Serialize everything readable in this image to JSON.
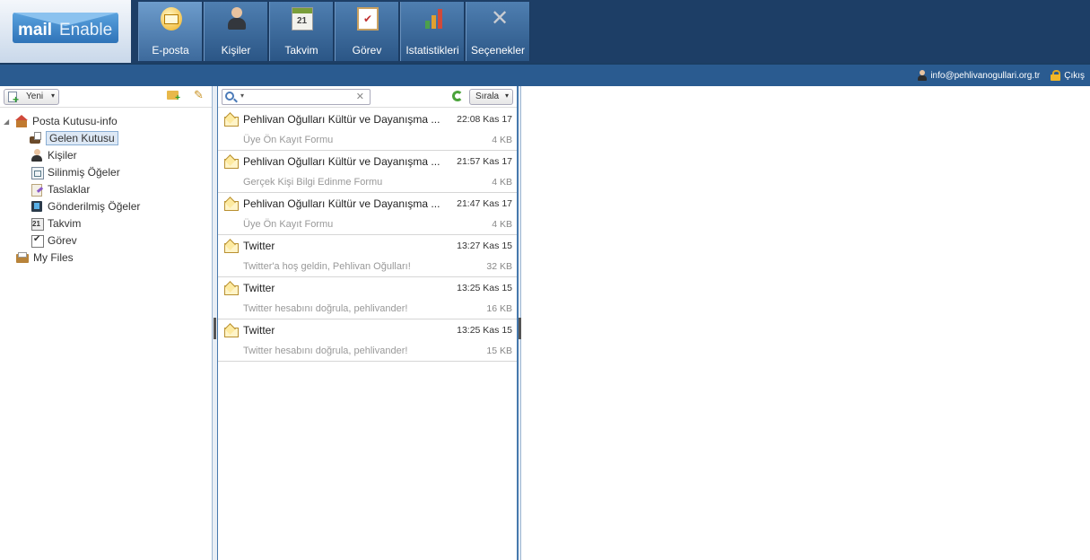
{
  "logo": {
    "mail": "mail",
    "enable": "Enable"
  },
  "nav": [
    {
      "label": "E-posta",
      "icon": "mail-icon"
    },
    {
      "label": "Kişiler",
      "icon": "contacts-icon"
    },
    {
      "label": "Takvim",
      "icon": "calendar-icon"
    },
    {
      "label": "Görev",
      "icon": "task-icon"
    },
    {
      "label": "Istatistikleri",
      "icon": "statistics-icon"
    },
    {
      "label": "Seçenekler",
      "icon": "tools-icon"
    }
  ],
  "user": {
    "email": "info@pehlivanogullari.org.tr",
    "logout": "Çıkış"
  },
  "left_toolbar": {
    "new_label": "Yeni",
    "new_caret": "▾"
  },
  "tree": {
    "root": "Posta Kutusu-info",
    "items": [
      {
        "label": "Gelen Kutusu",
        "icon": "inbox-icon",
        "selected": true
      },
      {
        "label": "Kişiler",
        "icon": "contacts-icon"
      },
      {
        "label": "Silinmiş Öğeler",
        "icon": "trash-icon"
      },
      {
        "label": "Taslaklar",
        "icon": "drafts-icon"
      },
      {
        "label": "Gönderilmiş Öğeler",
        "icon": "sent-icon"
      },
      {
        "label": "Takvim",
        "icon": "calendar-icon"
      },
      {
        "label": "Görev",
        "icon": "task-icon"
      }
    ],
    "files": "My Files"
  },
  "mid_toolbar": {
    "search_value": "",
    "sort_label": "Sırala",
    "caret": "▾",
    "clear": "✕"
  },
  "messages": [
    {
      "from": "Pehlivan Oğulları Kültür ve Dayanışma ...",
      "time": "22:08 Kas 17",
      "subject": "Üye Ön Kayıt Formu",
      "size": "4 KB"
    },
    {
      "from": "Pehlivan Oğulları Kültür ve Dayanışma ...",
      "time": "21:57 Kas 17",
      "subject": "Gerçek Kişi Bilgi Edinme Formu",
      "size": "4 KB"
    },
    {
      "from": "Pehlivan Oğulları Kültür ve Dayanışma ...",
      "time": "21:47 Kas 17",
      "subject": "Üye Ön Kayıt Formu",
      "size": "4 KB"
    },
    {
      "from": "Twitter",
      "time": "13:27 Kas 15",
      "subject": "Twitter'a hoş geldin, Pehlivan Oğulları!",
      "size": "32 KB"
    },
    {
      "from": "Twitter",
      "time": "13:25 Kas 15",
      "subject": "Twitter hesabını doğrula, pehlivander!",
      "size": "16 KB"
    },
    {
      "from": "Twitter",
      "time": "13:25 Kas 15",
      "subject": "Twitter hesabını doğrula, pehlivander!",
      "size": "15 KB"
    }
  ],
  "colors": {
    "topbar": "#1d3e66",
    "statusbar": "#2a5b90",
    "tab": "#3d6a9c",
    "selection": "#dde8f5"
  }
}
